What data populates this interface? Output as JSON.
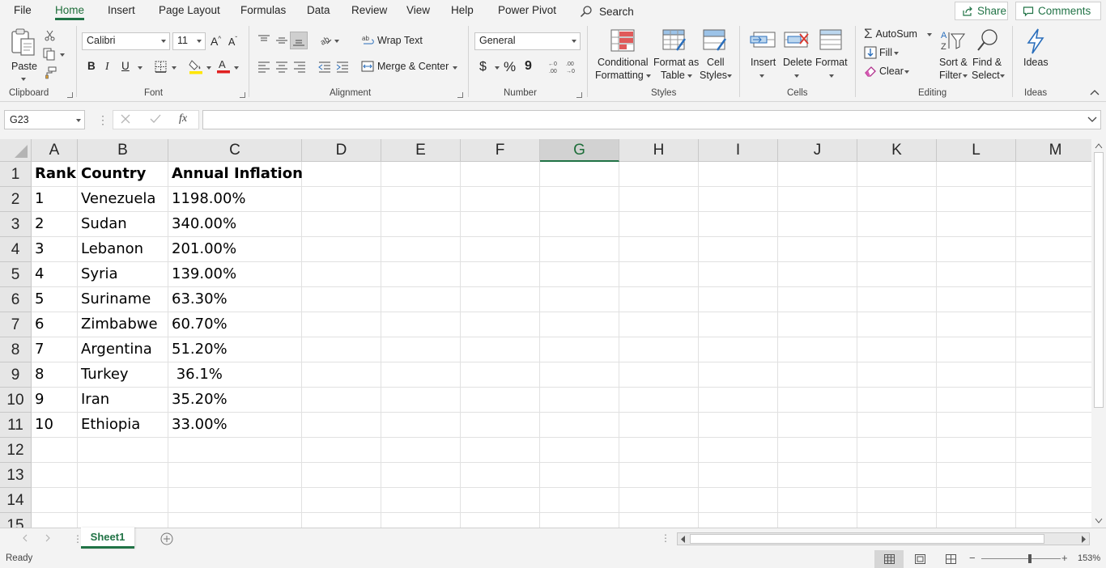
{
  "menu": {
    "tabs": [
      "File",
      "Home",
      "Insert",
      "Page Layout",
      "Formulas",
      "Data",
      "Review",
      "View",
      "Help",
      "Power Pivot"
    ],
    "active": "Home",
    "search_label": "Search",
    "share_label": "Share",
    "comments_label": "Comments"
  },
  "ribbon": {
    "clipboard": {
      "paste_label": "Paste",
      "group_label": "Clipboard"
    },
    "font": {
      "name": "Calibri",
      "size": "11",
      "bold": "B",
      "italic": "I",
      "underline": "U",
      "group_label": "Font",
      "fill_color": "#ffe600",
      "font_color": "#e02020"
    },
    "alignment": {
      "wrap_text": "Wrap Text",
      "merge_center": "Merge & Center",
      "group_label": "Alignment"
    },
    "number": {
      "format": "General",
      "currency": "$",
      "percent": "%",
      "comma": "9",
      "group_label": "Number"
    },
    "styles": {
      "conditional_1": "Conditional",
      "conditional_2": "Formatting",
      "format_table_1": "Format as",
      "format_table_2": "Table",
      "cell_styles_1": "Cell",
      "cell_styles_2": "Styles",
      "group_label": "Styles"
    },
    "cells": {
      "insert": "Insert",
      "delete": "Delete",
      "format": "Format",
      "group_label": "Cells"
    },
    "editing": {
      "autosum": "AutoSum",
      "fill": "Fill",
      "clear": "Clear",
      "sort_1": "Sort &",
      "sort_2": "Filter",
      "find_1": "Find &",
      "find_2": "Select",
      "group_label": "Editing"
    },
    "ideas": {
      "label": "Ideas",
      "group_label": "Ideas"
    }
  },
  "formula_bar": {
    "name_box": "G23",
    "fx": "fx",
    "value": ""
  },
  "columns": [
    "A",
    "B",
    "C",
    "D",
    "E",
    "F",
    "G",
    "H",
    "I",
    "J",
    "K",
    "L",
    "M"
  ],
  "selected_column": "G",
  "rows": [
    "1",
    "2",
    "3",
    "4",
    "5",
    "6",
    "7",
    "8",
    "9",
    "10",
    "11",
    "12",
    "13",
    "14",
    "15"
  ],
  "table": {
    "header": [
      "Rank",
      "Country",
      "Annual Inflation"
    ],
    "rows": [
      [
        "1",
        "Venezuela",
        "1198.00%"
      ],
      [
        "2",
        "Sudan",
        "340.00%"
      ],
      [
        "3",
        "Lebanon",
        "201.00%"
      ],
      [
        "4",
        "Syria",
        "139.00%"
      ],
      [
        "5",
        "Suriname",
        "63.30%"
      ],
      [
        "6",
        "Zimbabwe",
        "60.70%"
      ],
      [
        "7",
        "Argentina",
        "51.20%"
      ],
      [
        "8",
        "Turkey",
        " 36.1%"
      ],
      [
        "9",
        "Iran",
        "35.20%"
      ],
      [
        "10",
        "Ethiopia",
        "33.00%"
      ]
    ]
  },
  "sheets": {
    "active": "Sheet1"
  },
  "status": {
    "ready": "Ready",
    "zoom": "153%",
    "zoom_level": 0.62
  },
  "colors": {
    "accent": "#217346",
    "grid_line": "#e1e1e1",
    "header_bg": "#e6e6e6"
  }
}
